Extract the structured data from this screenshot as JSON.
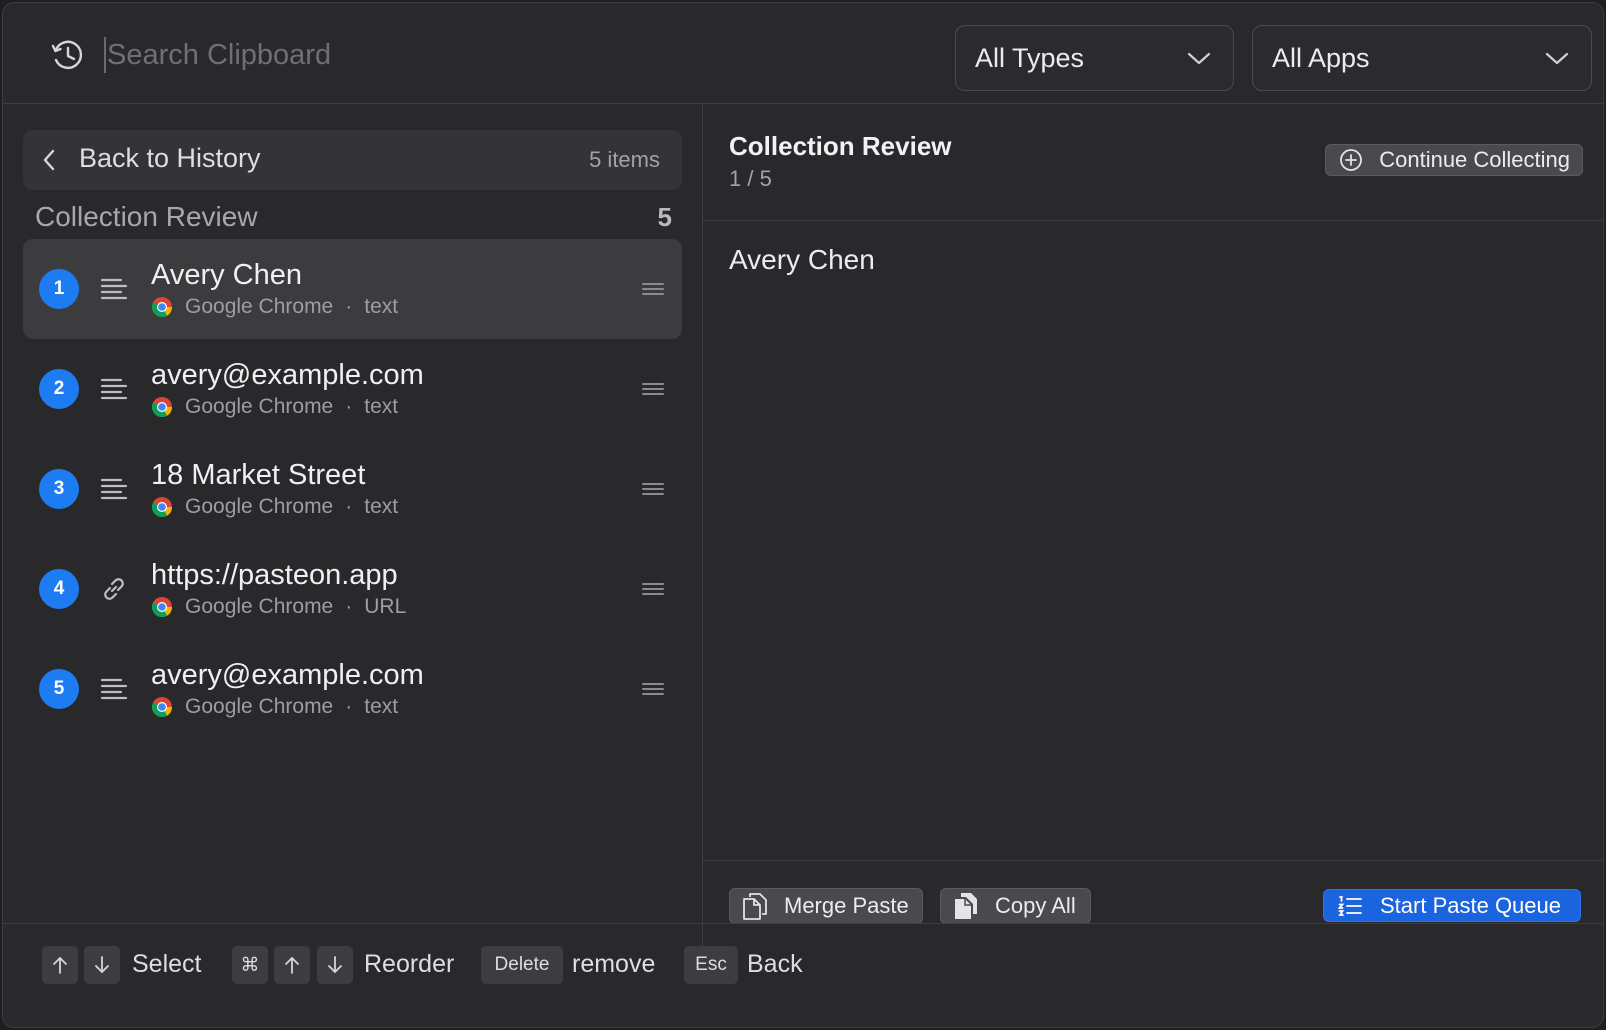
{
  "search": {
    "placeholder": "Search Clipboard"
  },
  "filters": {
    "type": "All Types",
    "app": "All Apps"
  },
  "left": {
    "back_label": "Back to History",
    "items_count": "5 items",
    "section_title": "Collection Review",
    "section_count": "5",
    "items": [
      {
        "index": "1",
        "title": "Avery Chen",
        "app": "Google Chrome",
        "sep": "·",
        "kind": "text",
        "icon": "text-lines-icon",
        "selected": true
      },
      {
        "index": "2",
        "title": "avery@example.com",
        "app": "Google Chrome",
        "sep": "·",
        "kind": "text",
        "icon": "text-lines-icon",
        "selected": false
      },
      {
        "index": "3",
        "title": "18 Market Street",
        "app": "Google Chrome",
        "sep": "·",
        "kind": "text",
        "icon": "text-lines-icon",
        "selected": false
      },
      {
        "index": "4",
        "title": "https://pasteon.app",
        "app": "Google Chrome",
        "sep": "·",
        "kind": "URL",
        "icon": "link-icon",
        "selected": false
      },
      {
        "index": "5",
        "title": "avery@example.com",
        "app": "Google Chrome",
        "sep": "·",
        "kind": "text",
        "icon": "text-lines-icon",
        "selected": false
      }
    ]
  },
  "right": {
    "title": "Collection Review",
    "position": "1 / 5",
    "continue_label": "Continue Collecting",
    "preview_text": "Avery Chen",
    "merge_label": "Merge Paste",
    "copy_all_label": "Copy All",
    "queue_label": "Start Paste Queue"
  },
  "footer": {
    "select_label": "Select",
    "reorder_label": "Reorder",
    "cmd_key": "⌘",
    "delete_key": "Delete",
    "remove_label": "remove",
    "esc_key": "Esc",
    "back_label": "Back"
  },
  "colors": {
    "accent": "#1d7cf2",
    "primary_button": "#1b64df",
    "background": "#29292c"
  }
}
